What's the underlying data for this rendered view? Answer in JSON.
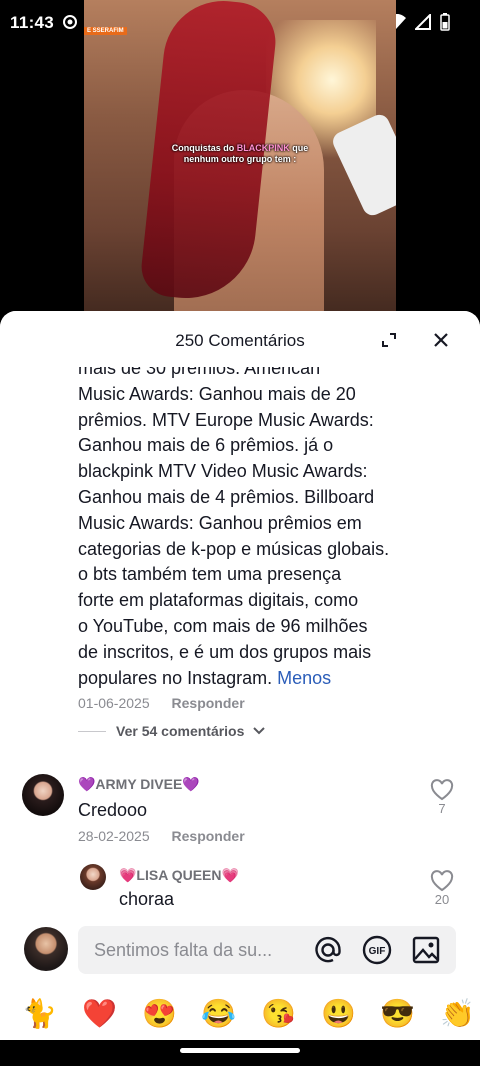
{
  "status_bar": {
    "time": "11:43"
  },
  "video": {
    "caption_line1_prefix": "Conquistas do ",
    "caption_highlight": "BLACKPINK",
    "caption_line1_suffix": " que",
    "caption_line2": "nenhum outro grupo tem :",
    "tag": "E SSERAFIM"
  },
  "comments_sheet": {
    "title": "250 Comentários",
    "expanded_comment": {
      "text": "mais de 30 prêmios. American\nMusic Awards: Ganhou mais de 20\nprêmios. MTV Europe Music Awards:\nGanhou mais de 6 prêmios.  já o\nblackpink  MTV Video Music Awards:\nGanhou mais de 4 prêmios. Billboard\nMusic Awards: Ganhou prêmios em\ncategorias de k-pop e músicas globais.\no bts  também tem uma presença\nforte em plataformas digitais, como\no YouTube, com mais de 96 milhões\nde inscritos, e é um dos grupos mais\npopulares no Instagram.  ",
      "less_label": "Menos",
      "date": "01-06-2025",
      "reply_label": "Responder"
    },
    "view_replies_label": "Ver 54 comentários",
    "comments": [
      {
        "username": "💜ARMY DIVEE💜",
        "text": "Credooo",
        "date": "28-02-2025",
        "reply_label": "Responder",
        "likes": "7"
      },
      {
        "username": "💗LISA QUEEN💗",
        "text": "choraa",
        "likes": "20"
      }
    ],
    "input": {
      "placeholder": "Sentimos falta da su..."
    },
    "emoji_bar": [
      "🐈",
      "❤️",
      "😍",
      "😂",
      "😘",
      "😃",
      "😎",
      "👏"
    ]
  },
  "colors": {
    "accent_link": "#2b5db9",
    "heart_red": "#e0202e"
  }
}
